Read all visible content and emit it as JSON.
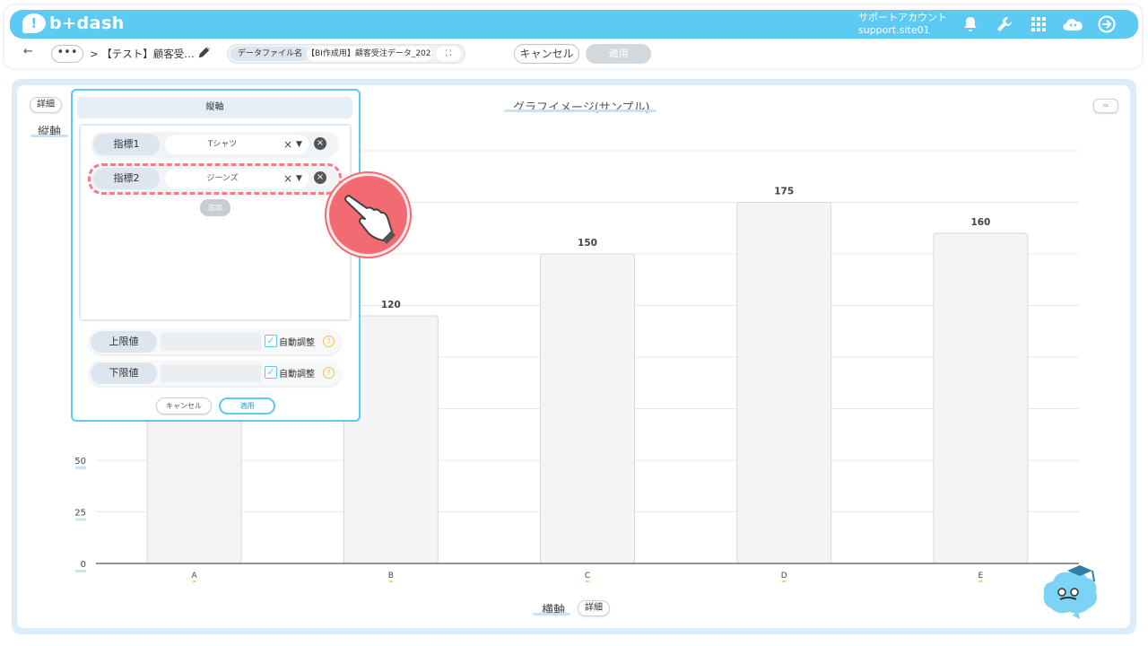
{
  "header": {
    "logo": "b+dash",
    "account_label": "サポートアカウント",
    "account_id": "support.site01"
  },
  "toolbar": {
    "more": "•••",
    "breadcrumb": ">  【テスト】顧客受…",
    "file_label": "データファイル名",
    "file_value": "【BI作成用】顧客受注データ_202…",
    "expand": "⛶",
    "cancel": "キャンセル",
    "apply": "適用"
  },
  "chart_area": {
    "title": "グラフイメージ(サンプル)",
    "y_detail": "詳細",
    "y_axis_title": "縦軸",
    "x_axis_title": "横軸",
    "x_detail": "詳細"
  },
  "panel": {
    "tab": "縦軸",
    "metrics": [
      {
        "label": "指標1",
        "value": "Tシャツ"
      },
      {
        "label": "指標2",
        "value": "ジーンズ"
      }
    ],
    "add": "追加",
    "upper_label": "上限値",
    "lower_label": "下限値",
    "auto_label": "自動調整",
    "cancel": "キャンセル",
    "apply": "適用"
  },
  "chart_data": {
    "type": "bar",
    "title": "グラフイメージ(サンプル)",
    "xlabel": "横軸",
    "ylabel": "縦軸",
    "categories": [
      "A",
      "B",
      "C",
      "D",
      "E"
    ],
    "values": [
      100,
      120,
      150,
      175,
      160
    ],
    "data_labels": [
      "",
      "120",
      "150",
      "175",
      "160"
    ],
    "y_ticks": [
      "0",
      "25",
      "50"
    ],
    "ylim": [
      0,
      200
    ],
    "grid": true,
    "bar_color": "#f4f4f4"
  },
  "colors": {
    "accent": "#5ccaf2",
    "highlight": "#f26a72"
  }
}
